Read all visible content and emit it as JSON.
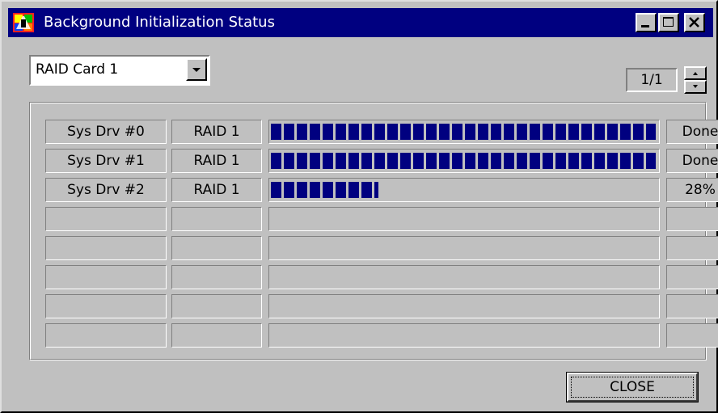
{
  "window": {
    "title": "Background Initialization Status",
    "accent_color": "#000080",
    "icon": "raid-app-icon"
  },
  "title_buttons": {
    "minimize_icon": "minimize-icon",
    "maximize_icon": "maximize-icon",
    "close_icon": "close-icon"
  },
  "controller_select": {
    "value": "RAID Card 1",
    "arrow_icon": "chevron-down-icon"
  },
  "pager": {
    "text": "1/1",
    "up_icon": "spin-up-icon",
    "down_icon": "spin-down-icon"
  },
  "drives": [
    {
      "name": "Sys Drv #0",
      "raid": "RAID 1",
      "progress": 1.0,
      "status": "Done"
    },
    {
      "name": "Sys Drv #1",
      "raid": "RAID 1",
      "progress": 1.0,
      "status": "Done"
    },
    {
      "name": "Sys Drv #2",
      "raid": "RAID 1",
      "progress": 0.28,
      "status": "28%"
    },
    {
      "name": "",
      "raid": "",
      "progress": 0,
      "status": ""
    },
    {
      "name": "",
      "raid": "",
      "progress": 0,
      "status": ""
    },
    {
      "name": "",
      "raid": "",
      "progress": 0,
      "status": ""
    },
    {
      "name": "",
      "raid": "",
      "progress": 0,
      "status": ""
    },
    {
      "name": "",
      "raid": "",
      "progress": 0,
      "status": ""
    }
  ],
  "progress_color": "#000080",
  "close_button": {
    "label": "CLOSE"
  }
}
